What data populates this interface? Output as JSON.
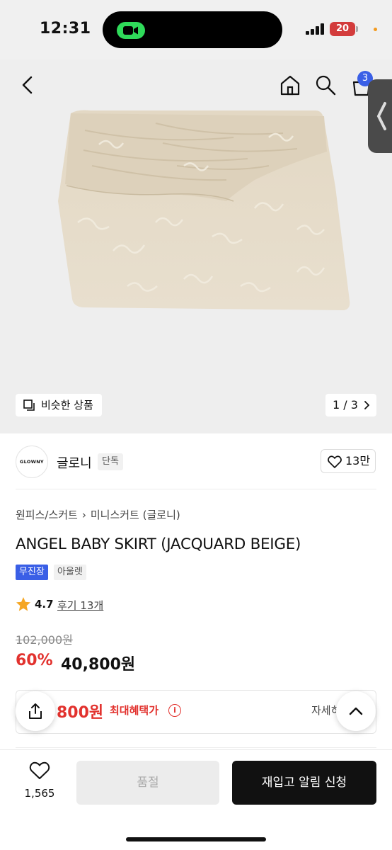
{
  "status_bar": {
    "time": "12:31",
    "battery": "20",
    "colors": {
      "facetime_pill": "#2fdb5a",
      "battery": "#d33c3c"
    }
  },
  "nav": {
    "cart_count": "3"
  },
  "gallery": {
    "similar_label": "비슷한 상품",
    "pager": "1 / 3"
  },
  "brand": {
    "logo_text": "GLOWNY",
    "name": "글로니",
    "badge": "단독",
    "likes": "13만"
  },
  "product": {
    "breadcrumb": [
      "원피스/스커트",
      "미니스커트 (글로니)"
    ],
    "title": "ANGEL BABY SKIRT (JACQUARD BEIGE)",
    "tags": [
      "무진장",
      "아울렛"
    ],
    "rating": "4.7",
    "reviews": "후기 13개",
    "original_price": "102,000원",
    "discount": "60%",
    "sale_price": "40,800원"
  },
  "benefit": {
    "amount": "800원",
    "label": "최대혜택가",
    "details": "자세히"
  },
  "bottom_bar": {
    "wish_count": "1,565",
    "soldout_label": "품절",
    "restock_label": "재입고 알림 신청"
  },
  "colors": {
    "accent_blue": "#3a5fe6",
    "sale_red": "#e2322e",
    "primary_button": "#111111"
  },
  "icons": [
    "back-icon",
    "home-icon",
    "search-icon",
    "cart-icon",
    "similar-icon",
    "chevron-right-icon",
    "heart-icon",
    "star-icon",
    "info-icon",
    "share-icon",
    "chevron-up-icon",
    "skirt-image"
  ]
}
